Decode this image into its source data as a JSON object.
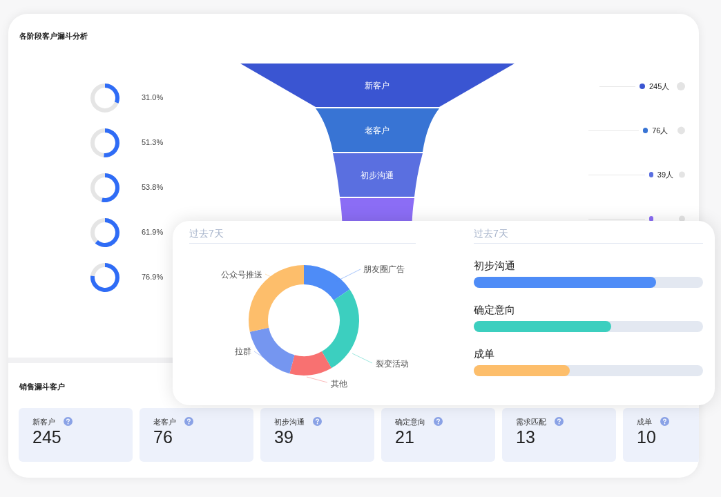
{
  "analysis": {
    "title": "各阶段客户漏斗分析",
    "conversion_rates": [
      {
        "reading": "31.0%"
      },
      {
        "reading": "51.3%"
      },
      {
        "reading": "53.8%"
      },
      {
        "reading": "61.9%"
      },
      {
        "reading": "76.9%"
      }
    ],
    "funnel": [
      {
        "label": "新客户",
        "count": "245人",
        "color": "#3a55d2"
      },
      {
        "label": "老客户",
        "count": "76人",
        "color": "#3874d4"
      },
      {
        "label": "初步沟通",
        "count": "39人",
        "color": "#5a6fe0"
      },
      {
        "color": "#8b6df5"
      }
    ]
  },
  "overlay": {
    "source_chart": {
      "header": "过去7天",
      "slices": [
        {
          "label": "朋友圈广告",
          "color": "#4e8cf7"
        },
        {
          "label": "裂变活动",
          "color": "#3ccfbf"
        },
        {
          "label": "其他",
          "color": "#f87171"
        },
        {
          "label": "拉群",
          "color": "#7596f0"
        },
        {
          "label": "公众号推送",
          "color": "#fdbe6b"
        }
      ]
    },
    "progress": {
      "header": "过去7天",
      "items": [
        {
          "label": "初步沟通",
          "level": 0.795,
          "color": "#4e8cf7"
        },
        {
          "label": "确定意向",
          "level": 0.6,
          "color": "#3ccfbf"
        },
        {
          "label": "成单",
          "level": 0.42,
          "color": "#fdbe6b"
        }
      ]
    }
  },
  "sales": {
    "title": "销售漏斗客户",
    "cards": [
      {
        "label": "新客户",
        "value": "245"
      },
      {
        "label": "老客户",
        "value": "76"
      },
      {
        "label": "初步沟通",
        "value": "39"
      },
      {
        "label": "确定意向",
        "value": "21"
      },
      {
        "label": "需求匹配",
        "value": "13"
      },
      {
        "label": "成单",
        "value": "10"
      }
    ]
  }
}
